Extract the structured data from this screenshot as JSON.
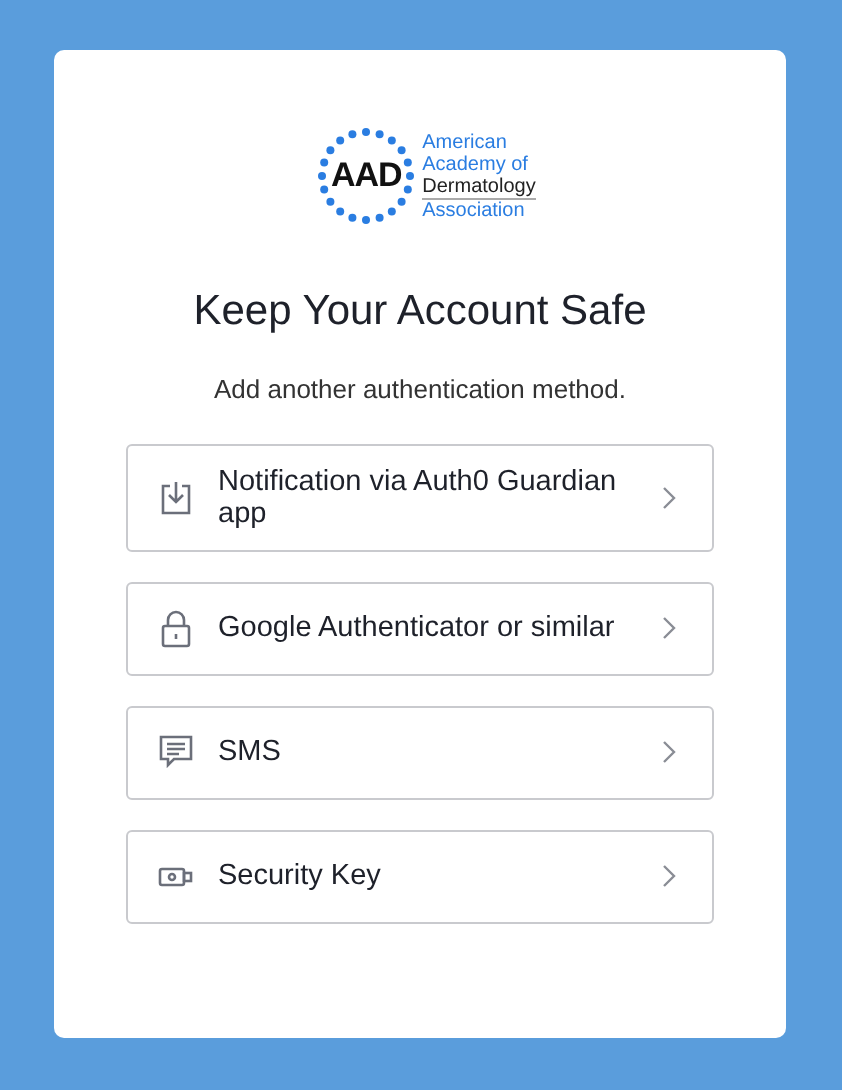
{
  "logo": {
    "mark": "AAD",
    "lines": [
      "American",
      "Academy of",
      "Dermatology",
      "Association"
    ]
  },
  "title": "Keep Your Account Safe",
  "subtitle": "Add another authentication method.",
  "options": [
    {
      "kind": "download",
      "label": "Notification via Auth0 Guardian app"
    },
    {
      "kind": "lock",
      "label": "Google Authenticator or similar"
    },
    {
      "kind": "sms",
      "label": "SMS"
    },
    {
      "kind": "key",
      "label": "Security Key"
    }
  ]
}
